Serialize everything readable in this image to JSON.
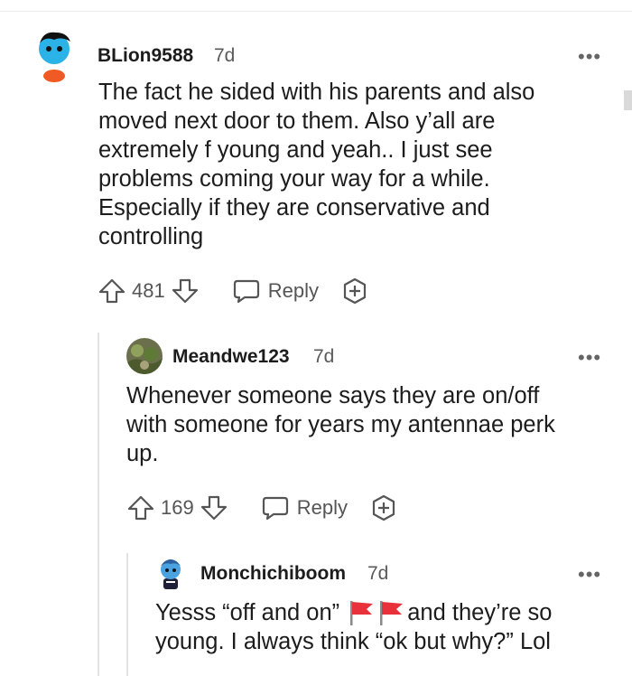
{
  "comments": [
    {
      "username": "BLion9588",
      "age": "7d",
      "lines": [
        "The fact he sided with his parents and also",
        "moved next door to them. Also y’all are",
        "extremely f young and yeah.. I just see",
        "problems coming your way for a while.",
        "Especially if they are conservative and",
        "controlling"
      ],
      "votes": "481",
      "reply_label": "Reply"
    },
    {
      "username": "Meandwe123",
      "age": "7d",
      "lines": [
        "Whenever someone says they are on/off",
        "with someone for years my antennae perk",
        "up."
      ],
      "votes": "169",
      "reply_label": "Reply"
    },
    {
      "username": "Monchichiboom",
      "age": "7d",
      "line1_before": "Yesss “off and on” ",
      "line1_after": "and they’re so",
      "line2": "young. I always think “ok but why?” Lol"
    }
  ],
  "more_glyph": "•••",
  "colors": {
    "flag": "#e8313a",
    "text": "#1c1c1c",
    "meta": "#5a5a5a"
  }
}
